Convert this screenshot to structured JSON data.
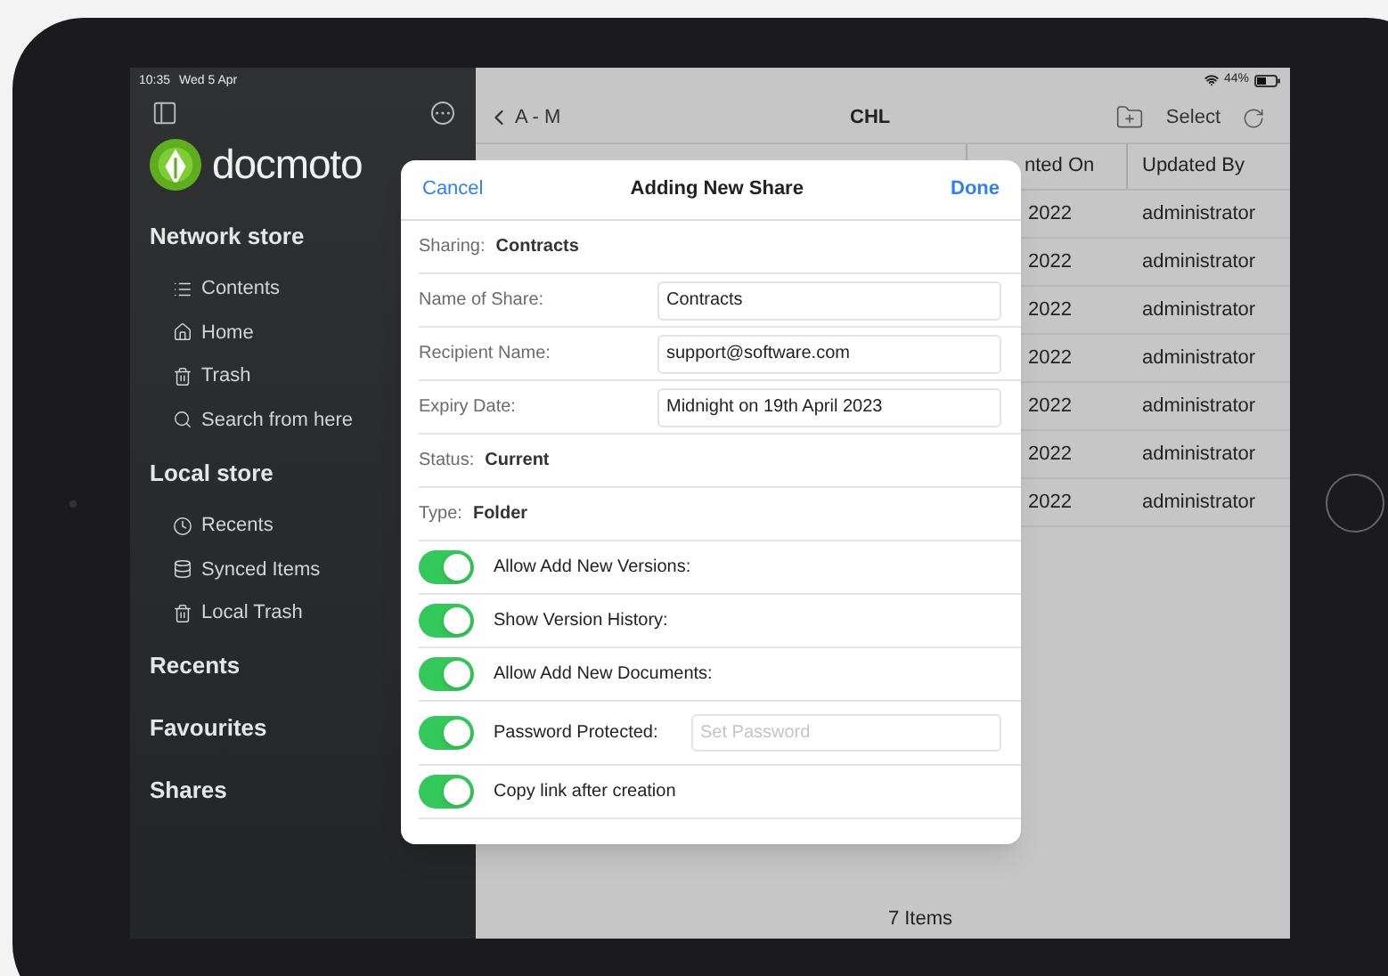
{
  "status_bar": {
    "time": "10:35",
    "date": "Wed 5 Apr",
    "battery": "44%"
  },
  "sidebar": {
    "logo": "docmoto",
    "sections": [
      {
        "title": "Network store",
        "items": [
          "Contents",
          "Home",
          "Trash",
          "Search from here"
        ]
      },
      {
        "title": "Local store",
        "items": [
          "Recents",
          "Synced Items",
          "Local Trash"
        ]
      },
      {
        "title": "Recents"
      },
      {
        "title": "Favourites"
      },
      {
        "title": "Shares"
      }
    ]
  },
  "nav": {
    "back": "A - M",
    "title": "CHL",
    "action": "Select"
  },
  "table": {
    "columns": [
      "nted On",
      "Updated By"
    ],
    "rows": [
      [
        "2022",
        "administrator"
      ],
      [
        "2022",
        "administrator"
      ],
      [
        "2022",
        "administrator"
      ],
      [
        "2022",
        "administrator"
      ],
      [
        "2022",
        "administrator"
      ],
      [
        "2022",
        "administrator"
      ],
      [
        "2022",
        "administrator"
      ]
    ],
    "footer": "7 Items"
  },
  "dialog": {
    "cancel": "Cancel",
    "title": "Adding New Share",
    "done": "Done",
    "rows": [
      {
        "kind": "info",
        "label": "Sharing:",
        "value": "Contracts"
      },
      {
        "kind": "field",
        "label": "Name of Share:",
        "value": "Contracts"
      },
      {
        "kind": "field",
        "label": "Recipient Name:",
        "value": "support@software.com"
      },
      {
        "kind": "field",
        "label": "Expiry Date:",
        "value": "Midnight on 19th April 2023"
      },
      {
        "kind": "info",
        "label": "Status:",
        "value": "Current"
      },
      {
        "kind": "info",
        "label": "Type:",
        "value": "Folder"
      },
      {
        "kind": "toggle",
        "label": "Allow Add New Versions:",
        "on": true
      },
      {
        "kind": "toggle",
        "label": "Show Version History:",
        "on": true
      },
      {
        "kind": "toggle",
        "label": "Allow Add New Documents:",
        "on": true
      },
      {
        "kind": "toggle_field",
        "label": "Password Protected:",
        "on": true,
        "placeholder": "Set Password"
      },
      {
        "kind": "toggle",
        "label": "Copy link after creation",
        "on": true
      }
    ]
  }
}
